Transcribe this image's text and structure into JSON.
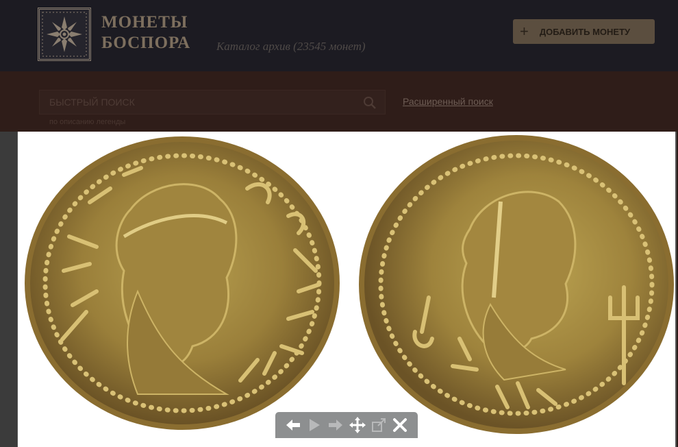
{
  "header": {
    "brand_line1": "МОНЕТЫ",
    "brand_line2": "БОСПОРА",
    "subtitle": "Каталог архив (23545 монет)",
    "add_button": {
      "label": "ДОБАВИТЬ МОНЕТУ",
      "icon": "plus-icon"
    }
  },
  "search": {
    "placeholder": "БЫСТРЫЙ ПОИСК",
    "hint": "по описанию легенды",
    "advanced_link": "Расширенный поиск"
  },
  "viewer": {
    "coins": [
      "obverse",
      "reverse"
    ],
    "toolbar": [
      {
        "icon": "arrow-left-icon",
        "enabled": true
      },
      {
        "icon": "play-icon",
        "enabled": false
      },
      {
        "icon": "arrow-right-icon",
        "enabled": false
      },
      {
        "icon": "move-icon",
        "enabled": true
      },
      {
        "icon": "external-link-icon",
        "enabled": false
      },
      {
        "icon": "close-icon",
        "enabled": true
      }
    ]
  },
  "colors": {
    "header_bg": "#1c1b22",
    "subbar_bg": "#2f1d19",
    "brand": "#7d6f5e",
    "button_bg": "#5b4e3f",
    "coin_gold": "#b99a4a"
  }
}
